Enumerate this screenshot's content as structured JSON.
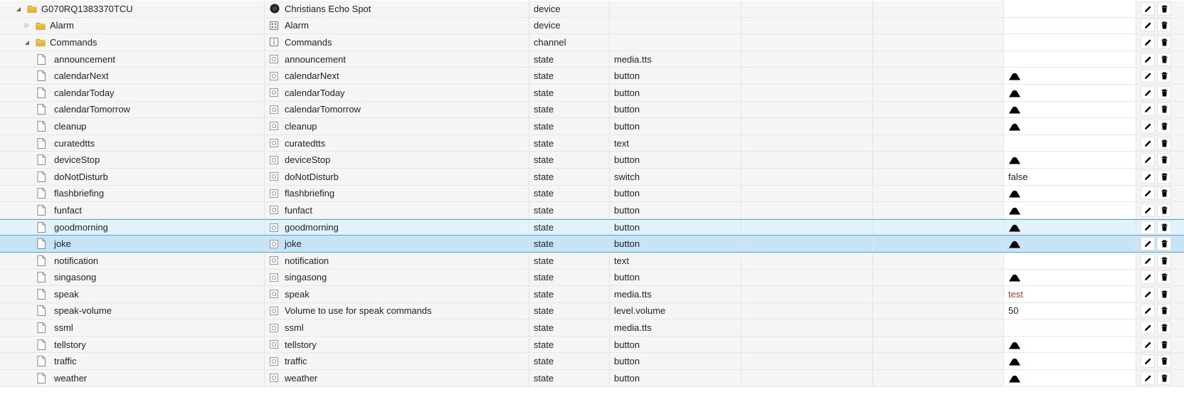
{
  "rows": [
    {
      "id": "G070RQ1383370TCU",
      "name": "Christians Echo Spot",
      "type": "device",
      "role": "",
      "value": "",
      "action": false,
      "level": 0,
      "expander": "expanded",
      "kind": "folder",
      "name_icon": "echo-device-icon",
      "row_state": ""
    },
    {
      "id": "Alarm",
      "name": "Alarm",
      "type": "device",
      "role": "",
      "value": "",
      "action": false,
      "level": 1,
      "expander": "collapsed",
      "kind": "folder",
      "name_icon": "calendar-icon",
      "row_state": ""
    },
    {
      "id": "Commands",
      "name": "Commands",
      "type": "channel",
      "role": "",
      "value": "",
      "action": false,
      "level": 1,
      "expander": "expanded",
      "kind": "folder",
      "name_icon": "info-icon",
      "row_state": ""
    },
    {
      "id": "announcement",
      "name": "announcement",
      "type": "state",
      "role": "media.tts",
      "value": "",
      "action": false,
      "level": 2,
      "kind": "file",
      "name_icon": "state-icon",
      "row_state": ""
    },
    {
      "id": "calendarNext",
      "name": "calendarNext",
      "type": "state",
      "role": "button",
      "value": "",
      "action": true,
      "level": 2,
      "kind": "file",
      "name_icon": "state-icon",
      "row_state": ""
    },
    {
      "id": "calendarToday",
      "name": "calendarToday",
      "type": "state",
      "role": "button",
      "value": "",
      "action": true,
      "level": 2,
      "kind": "file",
      "name_icon": "state-icon",
      "row_state": ""
    },
    {
      "id": "calendarTomorrow",
      "name": "calendarTomorrow",
      "type": "state",
      "role": "button",
      "value": "",
      "action": true,
      "level": 2,
      "kind": "file",
      "name_icon": "state-icon",
      "row_state": ""
    },
    {
      "id": "cleanup",
      "name": "cleanup",
      "type": "state",
      "role": "button",
      "value": "",
      "action": true,
      "level": 2,
      "kind": "file",
      "name_icon": "state-icon",
      "row_state": ""
    },
    {
      "id": "curatedtts",
      "name": "curatedtts",
      "type": "state",
      "role": "text",
      "value": "",
      "action": false,
      "level": 2,
      "kind": "file",
      "name_icon": "state-icon",
      "row_state": ""
    },
    {
      "id": "deviceStop",
      "name": "deviceStop",
      "type": "state",
      "role": "button",
      "value": "",
      "action": true,
      "level": 2,
      "kind": "file",
      "name_icon": "state-icon",
      "row_state": ""
    },
    {
      "id": "doNotDisturb",
      "name": "doNotDisturb",
      "type": "state",
      "role": "switch",
      "value": "false",
      "action": false,
      "level": 2,
      "kind": "file",
      "name_icon": "state-icon",
      "row_state": ""
    },
    {
      "id": "flashbriefing",
      "name": "flashbriefing",
      "type": "state",
      "role": "button",
      "value": "",
      "action": true,
      "level": 2,
      "kind": "file",
      "name_icon": "state-icon",
      "row_state": ""
    },
    {
      "id": "funfact",
      "name": "funfact",
      "type": "state",
      "role": "button",
      "value": "",
      "action": true,
      "level": 2,
      "kind": "file",
      "name_icon": "state-icon",
      "row_state": ""
    },
    {
      "id": "goodmorning",
      "name": "goodmorning",
      "type": "state",
      "role": "button",
      "value": "",
      "action": true,
      "level": 2,
      "kind": "file",
      "name_icon": "state-icon",
      "row_state": "hover"
    },
    {
      "id": "joke",
      "name": "joke",
      "type": "state",
      "role": "button",
      "value": "",
      "action": true,
      "level": 2,
      "kind": "file",
      "name_icon": "state-icon",
      "row_state": "selected"
    },
    {
      "id": "notification",
      "name": "notification",
      "type": "state",
      "role": "text",
      "value": "",
      "action": false,
      "level": 2,
      "kind": "file",
      "name_icon": "state-icon",
      "row_state": ""
    },
    {
      "id": "singasong",
      "name": "singasong",
      "type": "state",
      "role": "button",
      "value": "",
      "action": true,
      "level": 2,
      "kind": "file",
      "name_icon": "state-icon",
      "row_state": ""
    },
    {
      "id": "speak",
      "name": "speak",
      "type": "state",
      "role": "media.tts",
      "value": "test",
      "value_color": "#c0392b",
      "action": false,
      "level": 2,
      "kind": "file",
      "name_icon": "state-icon",
      "row_state": ""
    },
    {
      "id": "speak-volume",
      "name": "Volume to use for speak commands",
      "type": "state",
      "role": "level.volume",
      "value": "50",
      "action": false,
      "level": 2,
      "kind": "file",
      "name_icon": "state-icon",
      "row_state": ""
    },
    {
      "id": "ssml",
      "name": "ssml",
      "type": "state",
      "role": "media.tts",
      "value": "",
      "action": false,
      "level": 2,
      "kind": "file",
      "name_icon": "state-icon",
      "row_state": ""
    },
    {
      "id": "tellstory",
      "name": "tellstory",
      "type": "state",
      "role": "button",
      "value": "",
      "action": true,
      "level": 2,
      "kind": "file",
      "name_icon": "state-icon",
      "row_state": ""
    },
    {
      "id": "traffic",
      "name": "traffic",
      "type": "state",
      "role": "button",
      "value": "",
      "action": true,
      "level": 2,
      "kind": "file",
      "name_icon": "state-icon",
      "row_state": ""
    },
    {
      "id": "weather",
      "name": "weather",
      "type": "state",
      "role": "button",
      "value": "",
      "action": true,
      "level": 2,
      "kind": "file",
      "name_icon": "state-icon",
      "row_state": ""
    }
  ],
  "icons": {
    "expanded": "expanded-triangle-icon",
    "collapsed": "collapsed-triangle-icon",
    "folder": "folder-icon",
    "file": "file-icon",
    "action": "button-press-icon",
    "edit": "pencil-icon",
    "delete": "trash-icon"
  },
  "colors": {
    "folder": "#e8b92e",
    "selected_row": "#c6e4f5",
    "hover_row": "#e3f3fb",
    "row_border_accent": "#5aa7d8",
    "value_highlight": "#c0392b"
  }
}
